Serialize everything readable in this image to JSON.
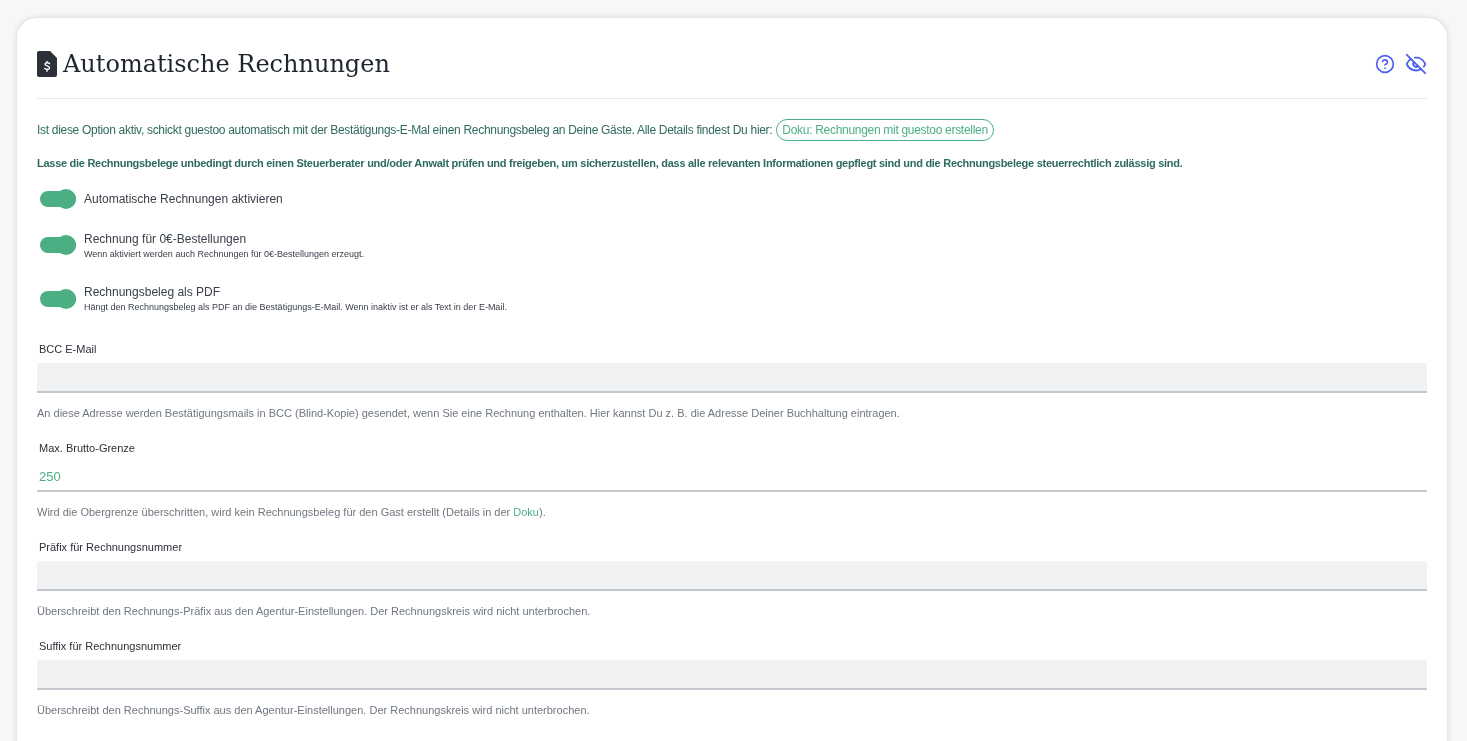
{
  "title": "Automatische Rechnungen",
  "intro": {
    "text": "Ist diese Option aktiv, schickt guestoo automatisch mit der Bestätigungs-E-Mal einen Rechnungsbeleg an Deine Gäste. Alle Details findest Du hier:",
    "link": "Doku: Rechnungen mit guestoo erstellen"
  },
  "warning": "Lasse die Rechnungsbelege unbedingt durch einen Steuerberater und/oder Anwalt prüfen und freigeben, um sicherzustellen, dass alle relevanten Informationen gepflegt sind und die Rechnungsbelege steuerrechtlich zulässig sind.",
  "toggles": [
    {
      "label": "Automatische Rechnungen aktivieren",
      "on": true
    },
    {
      "label": "Rechnung für 0€-Bestellungen",
      "hint": "Wenn aktiviert werden auch Rechnungen für 0€-Bestellungen erzeugt.",
      "on": true
    },
    {
      "label": "Rechnungsbeleg als PDF",
      "hint": "Hängt den Rechnungsbeleg als PDF an die Bestätigungs-E-Mail. Wenn inaktiv ist er als Text in der E-Mail.",
      "on": true
    }
  ],
  "fields": [
    {
      "label": "BCC E-Mail",
      "help": {
        "before": "An diese Adresse werden Bestätigungsmails in BCC (Blind-Kopie) gesendet, wenn Sie eine Rechnung enthalten. Hier kannst Du z. B. die Adresse Deiner Buchhaltung eintragen."
      }
    },
    {
      "label": "Max. Brutto-Grenze",
      "value": "250",
      "help": {
        "before": "Wird die Obergrenze überschritten, wird kein Rechnungsbeleg für den Gast erstellt (Details in der ",
        "link": "Doku",
        "after": ")."
      }
    },
    {
      "label": "Präfix für Rechnungsnummer",
      "help": {
        "before": "Überschreibt den Rechnungs-Präfix aus den Agentur-Einstellungen. Der Rechnungskreis wird nicht unterbrochen."
      }
    },
    {
      "label": "Suffix für Rechnungsnummer",
      "help": {
        "before": "Überschreibt den Rechnungs-Suffix aus den Agentur-Einstellungen. Der Rechnungskreis wird nicht unterbrochen."
      }
    }
  ]
}
